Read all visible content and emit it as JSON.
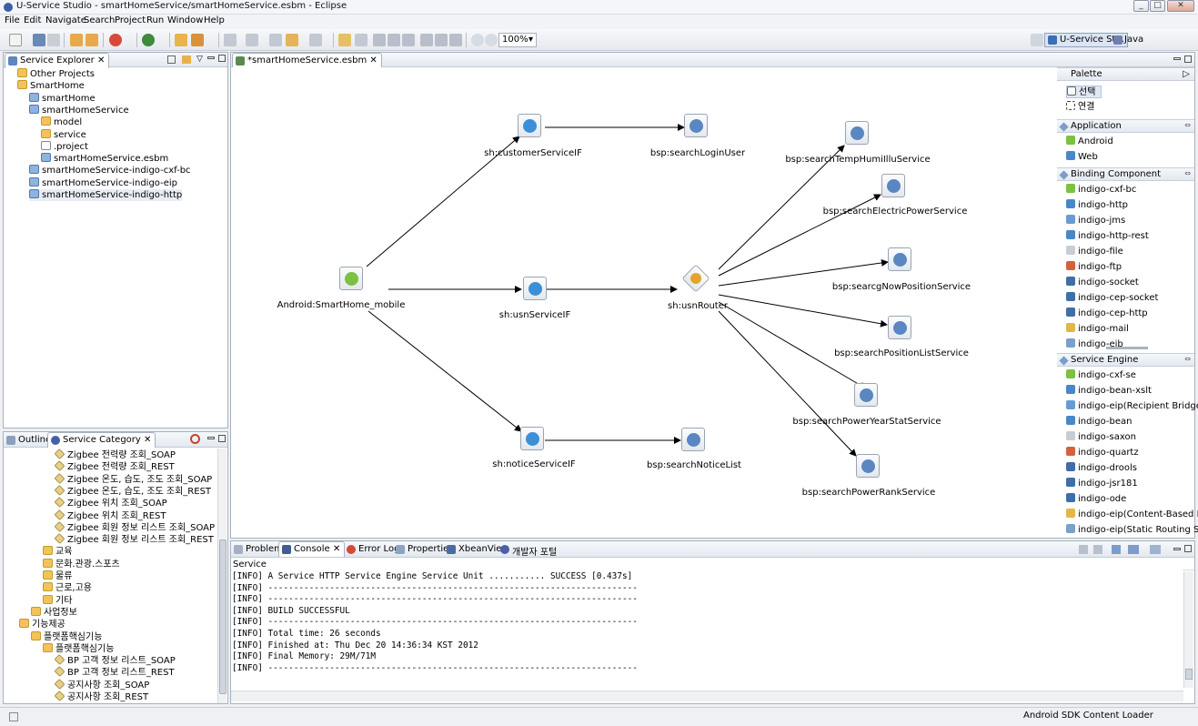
{
  "window": {
    "title": "U-Service Studio - smartHomeService/smartHomeService.esbm - Eclipse"
  },
  "menu": [
    "File",
    "Edit",
    "Navigate",
    "Search",
    "Project",
    "Run",
    "Window",
    "Help"
  ],
  "toolbar": {
    "zoom": "100%",
    "perspective_active": "U-Service St...",
    "perspective_other": "Java"
  },
  "explorer": {
    "tab": "Service Explorer",
    "items": [
      {
        "label": "Other Projects",
        "icon": "folder-icon",
        "indent": 1
      },
      {
        "label": "SmartHome",
        "icon": "folder-icon",
        "indent": 1
      },
      {
        "label": "smartHome",
        "icon": "project-icon",
        "indent": 2
      },
      {
        "label": "smartHomeService",
        "icon": "project-icon",
        "indent": 2
      },
      {
        "label": "model",
        "icon": "folder-icon",
        "indent": 3
      },
      {
        "label": "service",
        "icon": "folder-icon",
        "indent": 3
      },
      {
        "label": ".project",
        "icon": "file-icon",
        "indent": 3
      },
      {
        "label": "smartHomeService.esbm",
        "icon": "diagram-file-icon",
        "indent": 3
      },
      {
        "label": "smartHomeService-indigo-cxf-bc",
        "icon": "project-icon",
        "indent": 2
      },
      {
        "label": "smartHomeService-indigo-eip",
        "icon": "project-icon",
        "indent": 2
      },
      {
        "label": "smartHomeService-indigo-http",
        "icon": "project-icon",
        "indent": 2
      }
    ]
  },
  "category": {
    "tabs": [
      "Outline",
      "Service Category"
    ],
    "items": [
      {
        "label": "Zigbee 전력량 조회_SOAP",
        "icon": "service-icon",
        "indent": 4
      },
      {
        "label": "Zigbee 전력량 조회_REST",
        "icon": "service-icon",
        "indent": 4
      },
      {
        "label": "Zigbee 온도, 습도, 조도 조회_SOAP",
        "icon": "service-icon",
        "indent": 4
      },
      {
        "label": "Zigbee 온도, 습도, 조도 조회_REST",
        "icon": "service-icon",
        "indent": 4
      },
      {
        "label": "Zigbee 위치 조회_SOAP",
        "icon": "service-icon",
        "indent": 4
      },
      {
        "label": "Zigbee 위치 조회_REST",
        "icon": "service-icon",
        "indent": 4
      },
      {
        "label": "Zigbee 회원 정보 리스트 조회_SOAP",
        "icon": "service-icon",
        "indent": 4
      },
      {
        "label": "Zigbee 회원 정보 리스트 조회_REST",
        "icon": "service-icon",
        "indent": 4
      },
      {
        "label": "교육",
        "icon": "folder-icon",
        "indent": 3
      },
      {
        "label": "문화.관광.스포츠",
        "icon": "folder-icon",
        "indent": 3
      },
      {
        "label": "물류",
        "icon": "folder-icon",
        "indent": 3
      },
      {
        "label": "근로,고용",
        "icon": "folder-icon",
        "indent": 3
      },
      {
        "label": "기타",
        "icon": "folder-icon",
        "indent": 3
      },
      {
        "label": "사업정보",
        "icon": "folder-icon",
        "indent": 2
      },
      {
        "label": "기능제공",
        "icon": "folder-icon",
        "indent": 1
      },
      {
        "label": "플랫폼핵심기능",
        "icon": "folder-icon",
        "indent": 2
      },
      {
        "label": "플랫폼핵심기능",
        "icon": "folder-icon",
        "indent": 3
      },
      {
        "label": "BP 고객 정보 리스트_SOAP",
        "icon": "service-icon",
        "indent": 4
      },
      {
        "label": "BP 고객 정보 리스트_REST",
        "icon": "service-icon",
        "indent": 4
      },
      {
        "label": "공지사항 조회_SOAP",
        "icon": "service-icon",
        "indent": 4
      },
      {
        "label": "공지사항 조회_REST",
        "icon": "service-icon",
        "indent": 4
      }
    ]
  },
  "editor": {
    "tab": "*smartHomeService.esbm",
    "nodes": [
      {
        "id": "android",
        "label": "Android:SmartHome_mobile",
        "color": "#7cc142"
      },
      {
        "id": "customer",
        "label": "sh:customerServiceIF",
        "color": "#3b8fd8"
      },
      {
        "id": "usn",
        "label": "sh:usnServiceIF",
        "color": "#3b8fd8"
      },
      {
        "id": "notice",
        "label": "sh:noticeServiceIF",
        "color": "#3b8fd8"
      },
      {
        "id": "login",
        "label": "bsp:searchLoginUser",
        "color": "#5a86c2"
      },
      {
        "id": "router",
        "label": "sh:usnRouter",
        "color": "#e2a42f"
      },
      {
        "id": "noticeList",
        "label": "bsp:searchNoticeList",
        "color": "#5a86c2"
      },
      {
        "id": "temp",
        "label": "bsp:searchTempHumiIlluService",
        "color": "#5a86c2"
      },
      {
        "id": "electric",
        "label": "bsp:searchElectricPowerService",
        "color": "#5a86c2"
      },
      {
        "id": "nowpos",
        "label": "bsp:searcgNowPositionService",
        "color": "#5a86c2"
      },
      {
        "id": "poslist",
        "label": "bsp:searchPositionListService",
        "color": "#5a86c2"
      },
      {
        "id": "yearstat",
        "label": "bsp:searchPowerYearStatService",
        "color": "#5a86c2"
      },
      {
        "id": "rank",
        "label": "bsp:searchPowerRankService",
        "color": "#5a86c2"
      }
    ]
  },
  "palette": {
    "title": "Palette",
    "tools": [
      "선택",
      "연결"
    ],
    "groups": [
      {
        "name": "Application",
        "items": [
          "Android",
          "Web"
        ]
      },
      {
        "name": "Binding Component",
        "items": [
          "indigo-cxf-bc",
          "indigo-http",
          "indigo-jms",
          "indigo-http-rest",
          "indigo-file",
          "indigo-ftp",
          "indigo-socket",
          "indigo-cep-socket",
          "indigo-cep-http",
          "indigo-mail",
          "indigo-eib"
        ]
      },
      {
        "name": "Service Engine",
        "items": [
          "indigo-cxf-se",
          "indigo-bean-xslt",
          "indigo-eip(Recipient Bridge)",
          "indigo-bean",
          "indigo-saxon",
          "indigo-quartz",
          "indigo-drools",
          "indigo-jsr181",
          "indigo-ode",
          "indigo-eip(Content-Based Router)",
          "indigo-eip(Static Routing Slip)"
        ]
      }
    ]
  },
  "bottom": {
    "tabs": [
      "Problems",
      "Console",
      "Error Log",
      "Properties",
      "XbeanView",
      "개발자 포털"
    ],
    "header": "Service",
    "console": [
      "[INFO] A Service HTTP Service Engine Service Unit ........... SUCCESS [0.437s]",
      "[INFO] ------------------------------------------------------------------------",
      "[INFO] ------------------------------------------------------------------------",
      "[INFO] BUILD SUCCESSFUL",
      "[INFO] ------------------------------------------------------------------------",
      "[INFO] Total time: 26 seconds",
      "[INFO] Finished at: Thu Dec 20 14:36:34 KST 2012",
      "[INFO] Final Memory: 29M/71M",
      "[INFO] ------------------------------------------------------------------------"
    ]
  },
  "status": {
    "text": "Android SDK Content Loader"
  }
}
